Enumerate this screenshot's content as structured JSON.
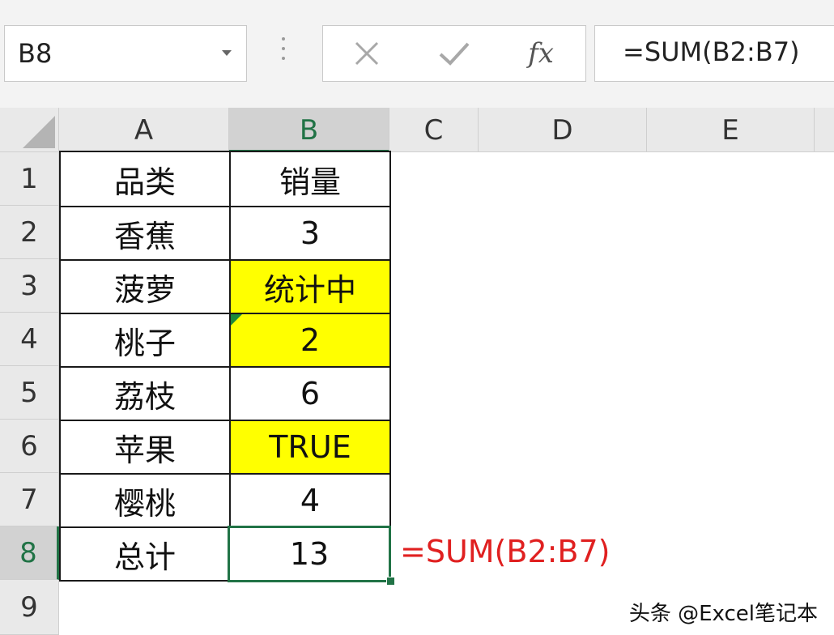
{
  "formula_bar": {
    "name_box": "B8",
    "fx_label": "fx",
    "formula": "=SUM(B2:B7)"
  },
  "columns": [
    "A",
    "B",
    "C",
    "D",
    "E"
  ],
  "rows": [
    "1",
    "2",
    "3",
    "4",
    "5",
    "6",
    "7",
    "8",
    "9"
  ],
  "cells": {
    "A1": "品类",
    "B1": "销量",
    "A2": "香蕉",
    "B2": "3",
    "A3": "菠萝",
    "B3": "统计中",
    "A4": "桃子",
    "B4": "2",
    "A5": "荔枝",
    "B5": "6",
    "A6": "苹果",
    "B6": "TRUE",
    "A7": "樱桃",
    "B7": "4",
    "A8": "总计",
    "B8": "13"
  },
  "annotation": "=SUM(B2:B7)",
  "watermark": "头条 @Excel笔记本",
  "colors": {
    "highlight": "#ffff00",
    "selection": "#217346",
    "annotation": "#e02020",
    "error_triangle": "#1e8a3a"
  }
}
